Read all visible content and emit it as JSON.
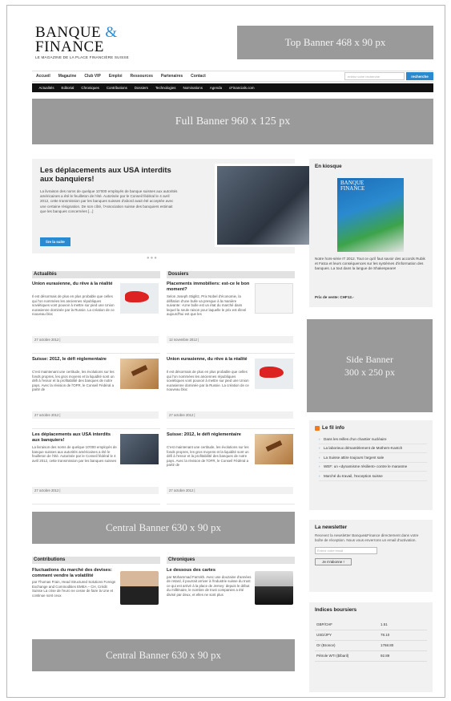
{
  "logo": {
    "line1": "BANQUE",
    "amp": "&",
    "line2": "FINANCE",
    "tagline": "LE MAGAZINE DE LA PLACE FINANCIÈRE SUISSE"
  },
  "banners": {
    "top": "Top Banner 468 x 90 px",
    "full": "Full Banner 960 x 125 px",
    "central1": "Central Banner 630 x 90 px",
    "central2": "Central Banner 630 x 90 px",
    "side_line1": "Side Banner",
    "side_line2": "300 x 250 px"
  },
  "nav": {
    "items": [
      "Accueil",
      "Magazine",
      "Club VIP",
      "Emploi",
      "Ressources",
      "Partenaires",
      "Contact"
    ],
    "search_placeholder": "entrez votre recherche",
    "search_button": "recherche"
  },
  "subnav": [
    "Actualités",
    "Editorial",
    "Chroniques",
    "Contributions",
    "Dossiers",
    "Technologies",
    "Nominations",
    "Agenda",
    "cFinancials.com"
  ],
  "featured": {
    "title": "Les déplacements aux USA interdits aux banquiers!",
    "text": "La livraison des noms de quelque 10'000 employés de banque suisses aux autorités américaines a été le feuilleton de l'été. Autorisée par le Conseil fédéral le 4 avril 2012, cette transmission par les banques suisses d'abord avait été acceptée avec une certaine résignation. De son côté, l'Association suisse des banquiers estimait que les banques concernées [...]",
    "button": "lire la suite"
  },
  "actualites": {
    "header": "Actualités",
    "articles": [
      {
        "title": "Union eurasienne, du rêve à la réalité",
        "text": "Il est désormais de plus en plus probable que celles qui l'on nommées les anciennes républiques soviétiques vont pouvoir à mettre sur pied une Union eurasienne dominée par la Russie. La création de ce nouveau bloc",
        "date": "27 octobre 2012 |"
      },
      {
        "title": "Suisse: 2012, le défi réglementaire",
        "text": "C'est maintenant une certitude, les évolutions sur les fonds propres, les gros moyens et la liquidité sont un défi à l'essor et la profitabilité des banques de notre pays. Avec la révision de l'OFR, le Conseil Fédéral a partir de",
        "date": "27 octobre 2012 |"
      },
      {
        "title": "Les déplacements aux USA interdits aux banquiers!",
        "text": "La livraison des noms de quelque 10'000 employés de banque suisses aux autorités américaines a été le feuilleton de l'été. Autorisée par le Conseil fédéral le 4 avril 2012, cette transmission par les banques suisses",
        "date": "27 octobre 2012 |"
      }
    ]
  },
  "dossiers": {
    "header": "Dossiers",
    "articles": [
      {
        "title": "Placements immobiliers: est-ce le bon moment?",
        "text": "Selon Joseph Stiglitz, Prix Nobel d'économie, la déflation d'une bulle va presque à la manière suivante: «Une bulle est un état du marché dans lequel la seule raison pour laquelle le prix est élevé aujourd'hui est que les",
        "date": "12 novembre 2012 |"
      },
      {
        "title": "Union eurasienne, du rêve à la réalité",
        "text": "Il est désormais de plus en plus probable que celles qui l'on nommées les anciennes républiques soviétiques vont pouvoir à mettre sur pied une Union eurasienne dominée par la Russie. La création de ce nouveau bloc",
        "date": "27 octobre 2012 |"
      },
      {
        "title": "Suisse: 2012, le défi réglementaire",
        "text": "C'est maintenant une certitude, les évolutions sur les fonds propres, les gros moyens et la liquidité sont un défi à l'essor et la profitabilité des banques de notre pays. Avec la révision de l'OFR, le Conseil Fédéral a partir de",
        "date": "27 octobre 2012 |"
      }
    ]
  },
  "contributions": {
    "header": "Contributions",
    "title": "Fluctuations du marché des devises: comment vendre la volatilité",
    "text": "par Thomas Frain, Head Structured Solutions Foreign Exchange and Commodities EMEA – CH, Crédit Suisse La crise de l'euro ne cesse de faire la Une et continue sont ceux"
  },
  "chroniques": {
    "header": "Chroniques",
    "title": "Le dessous des cartes",
    "text": "par Mohammad Farrokh. Avec une douzaine d'années de retard, il pourrait arriver à l'industrie suisse du trust ce qui est arrivé à la place de Jersey: depuis le début du millénaire, le nombre de trust companies a été divisé par deux, et elles ne sont plus"
  },
  "kiosk": {
    "title": "En kiosque",
    "cover_line1": "BANQUE",
    "cover_line2": "FINANCE",
    "text": "Notre hors-série IT 2012. Tout ce qu'il faut savoir des accords Rubik et Fatca et leurs conséquences sur les systèmes d'information des banques. La tout dans la langue de Shakespeare!",
    "price": "Prix de vente: CHF12.-"
  },
  "fil_info": {
    "title": "Le fil info",
    "items": [
      "Dans les reilles d'un chantier nucléaire",
      "La laborieux démantèlement de Mothern-Kantch",
      "La Suisse attire toujours l'argent sale",
      "WEF: un «dynamisme résilient» contre le marasme",
      "Marché du travail, l'exception suisse"
    ]
  },
  "newsletter": {
    "title": "La newsletter",
    "text": "Recevez la newsletter Banque&Finance directement dans votre boîte de réception. Nous vous enverrons un email d'activation.",
    "placeholder": "Entrez votre email",
    "button": "Je m'abonne !"
  },
  "indices": {
    "title": "Indices boursiers",
    "rows": [
      {
        "name": "GBP/CHF",
        "value": "1.51"
      },
      {
        "name": "USD/JPY",
        "value": "78.10"
      },
      {
        "name": "Or (Bronce)",
        "value": "1768.80"
      },
      {
        "name": "Pétrole WTI ($/baril)",
        "value": "92.89"
      }
    ]
  },
  "colors": {
    "accent": "#2a8ad0",
    "banner": "#9a9a9a",
    "navbar": "#111111"
  }
}
